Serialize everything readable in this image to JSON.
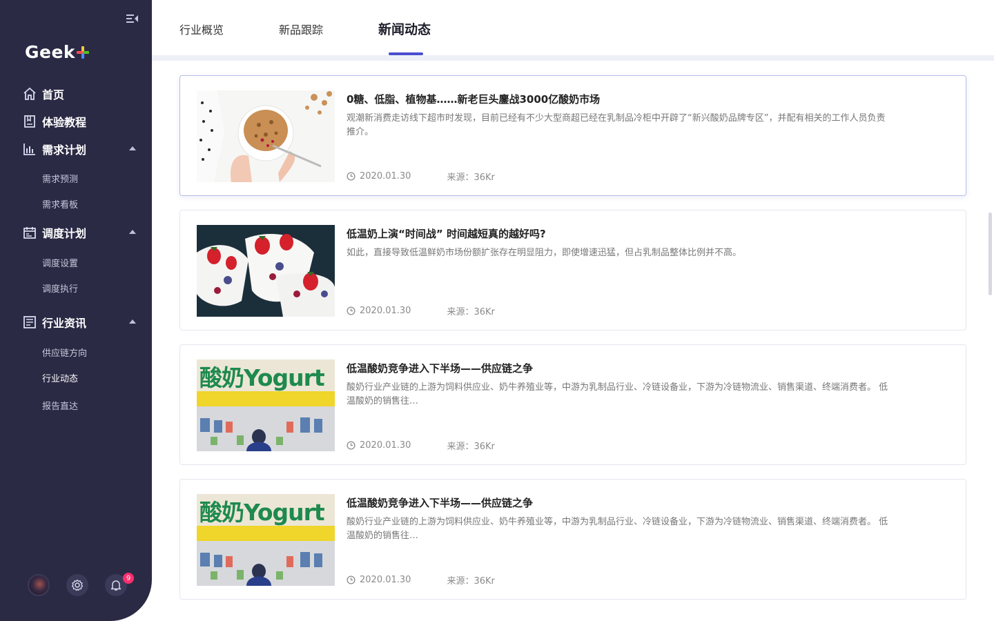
{
  "sidebar": {
    "logo_text": "Geek",
    "nav": [
      {
        "label": "首页",
        "icon": "home-icon"
      },
      {
        "label": "体验教程",
        "icon": "book-icon"
      },
      {
        "label": "需求计划",
        "icon": "bar-chart-icon",
        "children": [
          "需求预测",
          "需求看板"
        ]
      },
      {
        "label": "调度计划",
        "icon": "calendar-icon",
        "children": [
          "调度设置",
          "调度执行"
        ]
      },
      {
        "label": "行业资讯",
        "icon": "news-icon",
        "children": [
          "供应链方向",
          "行业动态",
          "报告直达"
        ]
      }
    ],
    "active_sub": "行业动态",
    "notification_count": "9"
  },
  "tabs": [
    "行业概览",
    "新品跟踪",
    "新闻动态"
  ],
  "active_tab": "新闻动态",
  "news": [
    {
      "title": "0糖、低脂、植物基……新老巨头鏖战3000亿酸奶市场",
      "desc": "观潮新消费走访线下超市时发现，目前已经有不少大型商超已经在乳制品冷柜中开辟了“新兴酸奶品牌专区”，并配有相关的工作人员负责推介。",
      "date": "2020.01.30",
      "source": "来源：36Kr"
    },
    {
      "title": "低温奶上演“时间战” 时间越短真的越好吗?",
      "desc": "如此，直接导致低温鲜奶市场份额扩张存在明显阻力，即使增速迅猛，但占乳制品整体比例并不高。",
      "date": "2020.01.30",
      "source": "来源：36Kr"
    },
    {
      "title": "低温酸奶竞争进入下半场——供应链之争",
      "desc": "酸奶行业产业链的上游为饲料供应业、奶牛养殖业等，中游为乳制品行业、冷链设备业，下游为冷链物流业、销售渠道、终端消费者。 低温酸奶的销售往…",
      "date": "2020.01.30",
      "source": "来源：36Kr",
      "image_text": "酸奶Yogurt"
    },
    {
      "title": "低温酸奶竞争进入下半场——供应链之争",
      "desc": "酸奶行业产业链的上游为饲料供应业、奶牛养殖业等，中游为乳制品行业、冷链设备业，下游为冷链物流业、销售渠道、终端消费者。 低温酸奶的销售往…",
      "date": "2020.01.30",
      "source": "来源：36Kr",
      "image_text": "酸奶Yogurt"
    }
  ],
  "colors": {
    "sidebar_bg": "#2b2a45",
    "accent": "#4a4ed0",
    "badge": "#ff2f6d",
    "logo_plus": [
      "#4a8df8",
      "#ff4d4f",
      "#ffc53d",
      "#52c41a"
    ]
  }
}
